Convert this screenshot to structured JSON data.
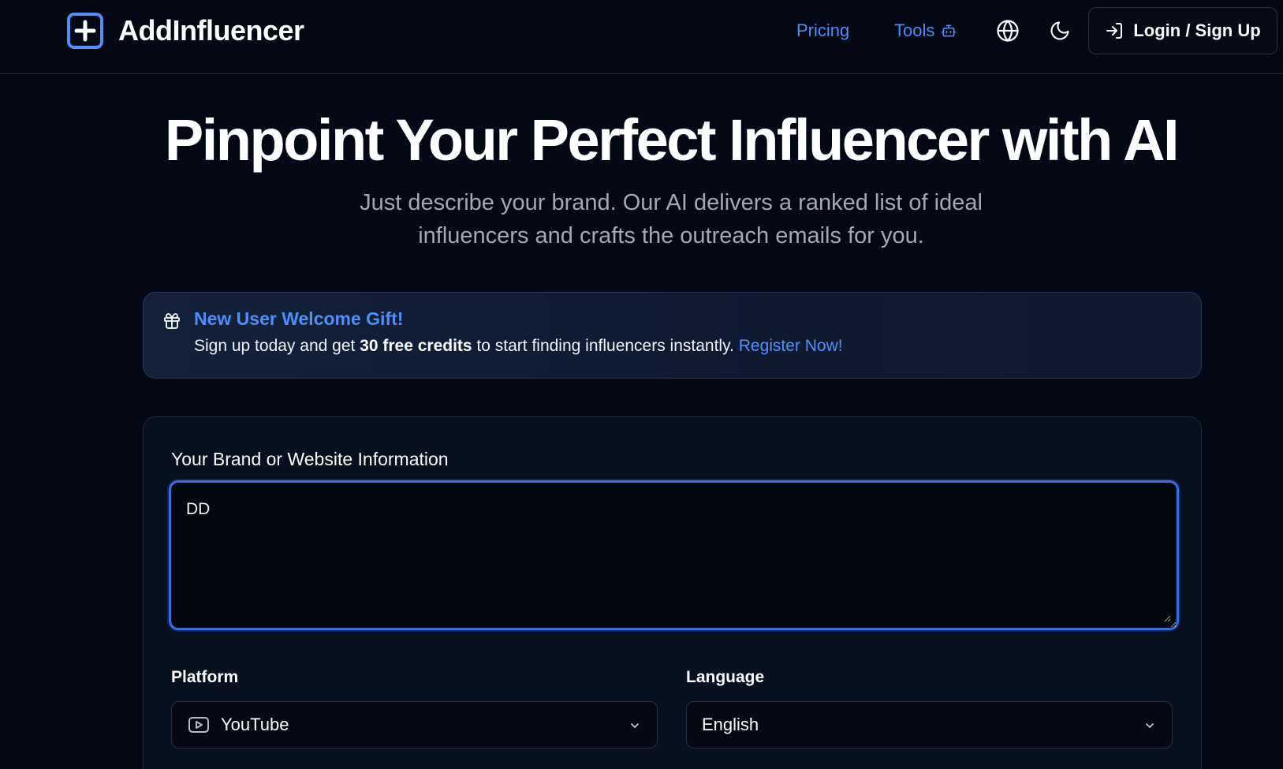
{
  "header": {
    "brand": "AddInfluencer",
    "nav": {
      "pricing": "Pricing",
      "tools": "Tools"
    },
    "login_label": "Login / Sign Up"
  },
  "hero": {
    "title": "Pinpoint Your Perfect Influencer with AI",
    "subtitle_line1": "Just describe your brand. Our AI delivers a ranked list of ideal",
    "subtitle_line2": "influencers and crafts the outreach emails for you."
  },
  "banner": {
    "title": "New User Welcome Gift!",
    "text_before": "Sign up today and get ",
    "text_bold": "30 free credits",
    "text_after": " to start finding influencers instantly. ",
    "link": "Register Now!"
  },
  "form": {
    "brand_label": "Your Brand or Website Information",
    "brand_value": "DD",
    "platform_label": "Platform",
    "platform_value": "YouTube",
    "language_label": "Language",
    "language_value": "English"
  },
  "colors": {
    "background": "#040814",
    "accent": "#4f8ff7",
    "focus_border": "#3b6fe0",
    "banner_bg": "#13213b",
    "text_muted": "#a3a8b3"
  },
  "icons": {
    "logo": "plus-square-icon",
    "tools": "robot-icon",
    "language": "globe-icon",
    "theme": "moon-icon",
    "login": "login-arrow-icon",
    "banner": "gift-icon",
    "platform": "youtube-icon",
    "select": "chevron-down-icon"
  }
}
